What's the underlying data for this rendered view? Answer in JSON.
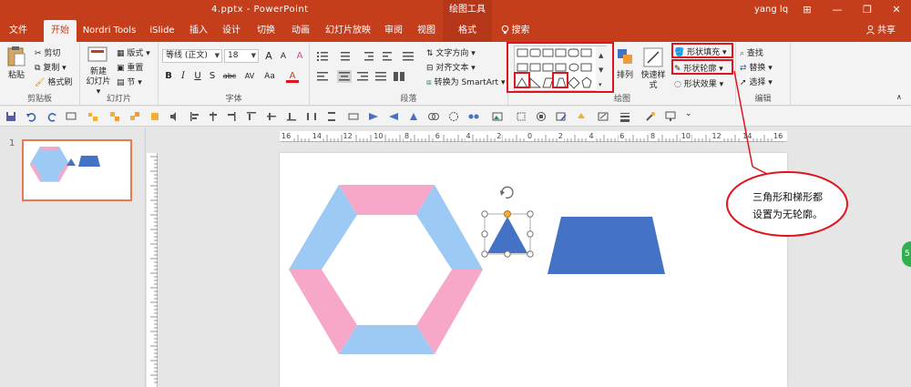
{
  "titlebar": {
    "doc_title": "4.pptx  -  PowerPoint",
    "context_header": "绘图工具",
    "user": "yang lq",
    "window_buttons": [
      "⊞",
      "—",
      "❐",
      "✕"
    ]
  },
  "tabs": [
    {
      "label": "文件"
    },
    {
      "label": "开始"
    },
    {
      "label": "Nordri Tools"
    },
    {
      "label": "iSlide"
    },
    {
      "label": "插入"
    },
    {
      "label": "设计"
    },
    {
      "label": "切换"
    },
    {
      "label": "动画"
    },
    {
      "label": "幻灯片放映"
    },
    {
      "label": "审阅"
    },
    {
      "label": "视图"
    },
    {
      "label": "格式"
    },
    {
      "label": "搜索"
    }
  ],
  "share_label": "共享",
  "ribbon": {
    "clipboard": {
      "label": "剪贴板",
      "paste": "粘贴",
      "cut": "剪切",
      "copy": "复制 ▾",
      "format_painter": "格式刷"
    },
    "slides": {
      "label": "幻灯片",
      "new_slide_line1": "新建",
      "new_slide_line2": "幻灯片 ▾",
      "layout": "版式 ▾",
      "reset": "重置",
      "section": "节 ▾"
    },
    "font": {
      "label": "字体",
      "font_name": "等线 (正文)",
      "font_size": "18",
      "grow": "A",
      "shrink": "A",
      "clear": "A",
      "bold": "B",
      "italic": "I",
      "underline": "U",
      "shadow": "S",
      "strike": "abc",
      "spacing": "AV",
      "case": "Aa",
      "color": "A"
    },
    "paragraph": {
      "label": "段落",
      "text_direction": "文字方向 ▾",
      "align_text": "对齐文本 ▾",
      "smartart": "转换为 SmartArt ▾"
    },
    "drawing": {
      "label": "绘图",
      "arrange": "排列",
      "quick_styles": "快速样式",
      "shape_fill": "形状填充 ▾",
      "shape_outline": "形状轮廓 ▾",
      "shape_effects": "形状效果 ▾"
    },
    "editing": {
      "label": "编辑",
      "find": "查找",
      "replace": "替换 ▾",
      "select": "选择 ▾"
    }
  },
  "thumbnail_number": "1",
  "ruler_labels": [
    "16",
    "14",
    "12",
    "10",
    "8",
    "6",
    "4",
    "2",
    "0",
    "2",
    "4",
    "6",
    "8",
    "10",
    "12",
    "14",
    "16"
  ],
  "callout_text": "三角形和梯形都设置为无轮廓。",
  "green_badge": "5",
  "colors": {
    "accent": "#c43e1c",
    "hexagon_blue": "#9ccaf5",
    "hexagon_pink": "#f7a8c9",
    "shape_blue": "#4472c4",
    "annotation_red": "#e0141e"
  }
}
